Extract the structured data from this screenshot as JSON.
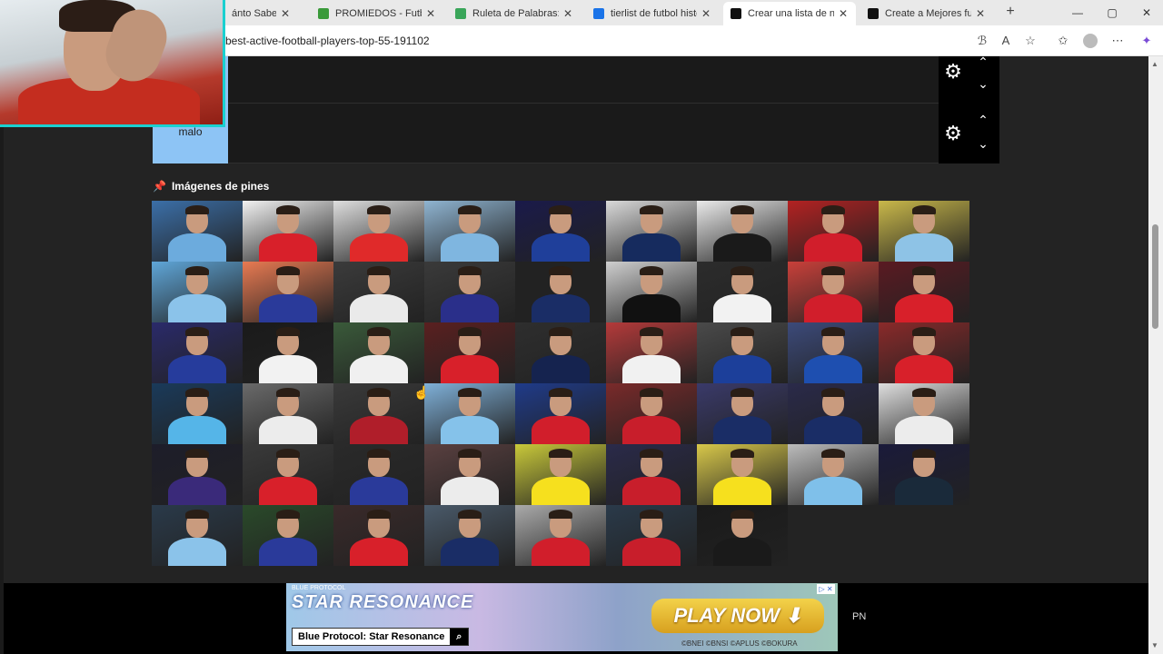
{
  "browser": {
    "tabs": [
      {
        "title": "ánto Sabes de F",
        "favicon_color": "#c0392b",
        "active": false
      },
      {
        "title": "PROMIEDOS - Futbol A",
        "favicon_color": "#3a9a3a",
        "active": false
      },
      {
        "title": "Ruleta de Palabras: PA",
        "favicon_color": "#3aa65a",
        "active": false
      },
      {
        "title": "tierlist de futbol histor",
        "favicon_color": "#1a73e8",
        "active": false
      },
      {
        "title": "Crear una lista de nive",
        "favicon_color": "#111111",
        "active": true
      },
      {
        "title": "Create a Mejores futbo",
        "favicon_color": "#111111",
        "active": false
      }
    ],
    "new_tab": "+",
    "window": {
      "minimize": "—",
      "maximize": "▢",
      "close": "✕"
    },
    "url": "best-active-football-players-top-55-191102"
  },
  "tiers": [
    {
      "label": "",
      "has_label": false
    },
    {
      "label": "malo",
      "has_label": true
    }
  ],
  "pins": {
    "title": "Imágenes de pines",
    "tiles": [
      {
        "bg": "#3b6fa8",
        "kit": "#6cabdd"
      },
      {
        "bg": "#f1f1f1",
        "kit": "#d8202a"
      },
      {
        "bg": "#dedede",
        "kit": "#e02a2a"
      },
      {
        "bg": "#8fb4d1",
        "kit": "#7fb6e0"
      },
      {
        "bg": "#1a1a4a",
        "kit": "#1f3f9a"
      },
      {
        "bg": "#d9d9d9",
        "kit": "#162b5e"
      },
      {
        "bg": "#eaeaea",
        "kit": "#1a1a1a"
      },
      {
        "bg": "#b32222",
        "kit": "#d11e2b"
      },
      {
        "bg": "#c9b84a",
        "kit": "#8ec3e6"
      },
      {
        "bg": "#5fa6d8",
        "kit": "#8bc3ea"
      },
      {
        "bg": "#e87a52",
        "kit": "#2a3a9a"
      },
      {
        "bg": "#3b3b3b",
        "kit": "#eaeaea"
      },
      {
        "bg": "#3a3a3a",
        "kit": "#2a2f8a"
      },
      {
        "bg": "#222222",
        "kit": "#1a2d66"
      },
      {
        "bg": "#cfcfcf",
        "kit": "#111111"
      },
      {
        "bg": "#2c2c2c",
        "kit": "#f2f2f2"
      },
      {
        "bg": "#c9403a",
        "kit": "#d11e2b"
      },
      {
        "bg": "#5a1a22",
        "kit": "#d8202a"
      },
      {
        "bg": "#2a2a6a",
        "kit": "#263c9c"
      },
      {
        "bg": "#1a1a1a",
        "kit": "#f2f2f2"
      },
      {
        "bg": "#3a5a3a",
        "kit": "#f0f0f0"
      },
      {
        "bg": "#5a2020",
        "kit": "#d8202a"
      },
      {
        "bg": "#2e2e2e",
        "kit": "#15234f"
      },
      {
        "bg": "#b43a3a",
        "kit": "#f1f1f1"
      },
      {
        "bg": "#4a4a4a",
        "kit": "#1c3f9a"
      },
      {
        "bg": "#3c4a7a",
        "kit": "#1e4fb0"
      },
      {
        "bg": "#8a2a2a",
        "kit": "#d8202a"
      },
      {
        "bg": "#1a3a5a",
        "kit": "#55b5e8"
      },
      {
        "bg": "#6a6a6a",
        "kit": "#ececec"
      },
      {
        "bg": "#3a3a3a",
        "kit": "#b01e2a"
      },
      {
        "bg": "#7fb0d8",
        "kit": "#85c2ea"
      },
      {
        "bg": "#1f3b8a",
        "kit": "#d11e2b"
      },
      {
        "bg": "#7a2a2a",
        "kit": "#c81e2b"
      },
      {
        "bg": "#3a3a6a",
        "kit": "#1a2d66"
      },
      {
        "bg": "#2a2a4a",
        "kit": "#1a2d66"
      },
      {
        "bg": "#dedede",
        "kit": "#ececec"
      },
      {
        "bg": "#1d1d2a",
        "kit": "#3a2a7a"
      },
      {
        "bg": "#3a3a3a",
        "kit": "#d8202a"
      },
      {
        "bg": "#2a2a2a",
        "kit": "#2a3a9a"
      },
      {
        "bg": "#5a4040",
        "kit": "#ececec"
      },
      {
        "bg": "#c9c93a",
        "kit": "#f6e01e"
      },
      {
        "bg": "#2a2a4a",
        "kit": "#c81e2b"
      },
      {
        "bg": "#d8c84a",
        "kit": "#f6e01e"
      },
      {
        "bg": "#bcbcbc",
        "kit": "#7fc0ea"
      },
      {
        "bg": "#1a1a3a",
        "kit": "#1a2a3a"
      },
      {
        "bg": "#2a3a4a",
        "kit": "#8bc3ea"
      },
      {
        "bg": "#2a4a2a",
        "kit": "#2a3a9a"
      },
      {
        "bg": "#3a2a2a",
        "kit": "#d8202a"
      },
      {
        "bg": "#4a5a6a",
        "kit": "#1a2d66"
      },
      {
        "bg": "#aaaaaa",
        "kit": "#d11e2b"
      },
      {
        "bg": "#2a3a4a",
        "kit": "#c81e2b"
      },
      {
        "bg": "#1a1a1a",
        "kit": "#1a1a1a"
      }
    ]
  },
  "ad": {
    "brand_small": "BLUE PROTOCOL",
    "logo": "STAR RESONANCE",
    "search_label": "Blue Protocol: Star Resonance",
    "cta": "PLAY NOW ⬇",
    "copyright": "©BNEI ©BNSI ©APLUS ©BOKURA",
    "side_text": "PN"
  }
}
